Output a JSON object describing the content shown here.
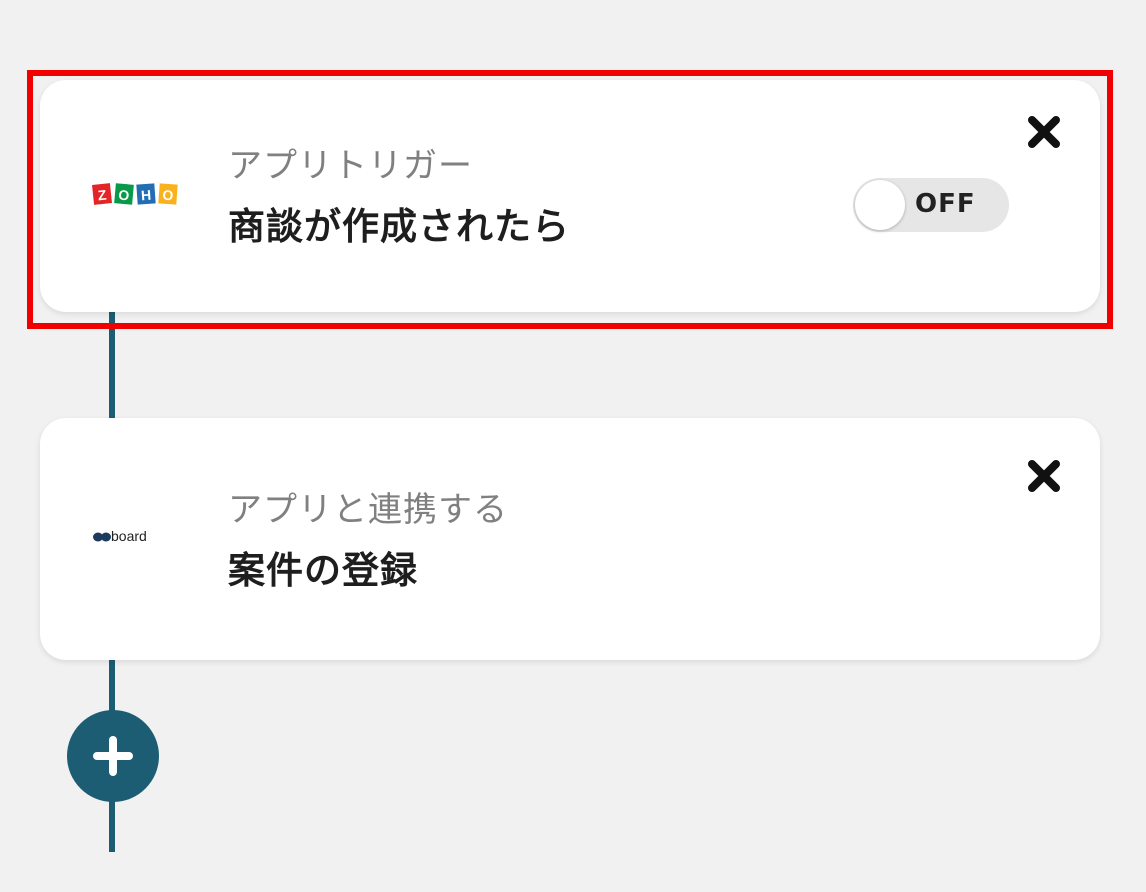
{
  "flow": {
    "steps": [
      {
        "app": "Zoho CRM",
        "app_icon": "zoho-logo",
        "type_label": "アプリトリガー",
        "title": "商談が作成されたら",
        "toggle": {
          "label": "OFF",
          "state": "off"
        },
        "close_icon": "close-icon",
        "highlighted": true
      },
      {
        "app": "board",
        "app_icon": "board-logo",
        "logo_text": "board",
        "type_label": "アプリと連携する",
        "title": "案件の登録",
        "close_icon": "close-icon",
        "highlighted": false
      }
    ],
    "add_step_icon": "plus-icon"
  },
  "colors": {
    "connector": "#1c5d73",
    "highlight_border": "#f00000",
    "background": "#f1f1f1",
    "card": "#ffffff",
    "zoho": [
      "#e42527",
      "#089949",
      "#226db4",
      "#f9b21d"
    ]
  }
}
